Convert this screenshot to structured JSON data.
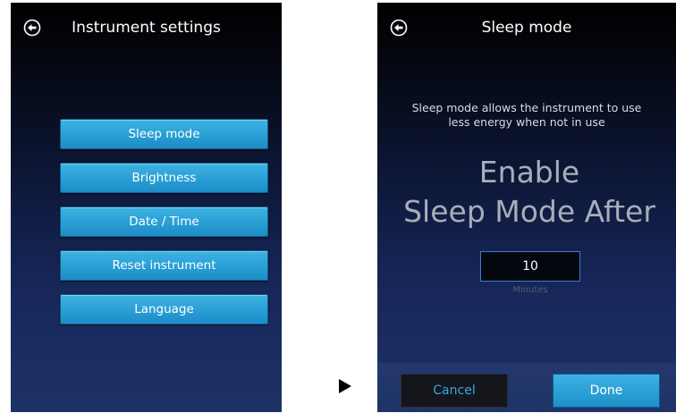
{
  "left_screen": {
    "title": "Instrument settings",
    "back_icon": "back-arrow-circle-icon",
    "menu": [
      {
        "label": "Sleep mode"
      },
      {
        "label": "Brightness"
      },
      {
        "label": "Date / Time"
      },
      {
        "label": "Reset instrument"
      },
      {
        "label": "Language"
      }
    ]
  },
  "right_screen": {
    "title": "Sleep mode",
    "back_icon": "back-arrow-circle-icon",
    "description_line1": "Sleep mode allows the instrument to use",
    "description_line2": "less energy when not in use",
    "heading_line1": "Enable",
    "heading_line2": "Sleep Mode After",
    "minutes_value": "10",
    "minutes_label": "Minutes",
    "cancel_label": "Cancel",
    "done_label": "Done"
  },
  "transition_icon": "right-triangle-arrow-icon",
  "colors": {
    "button_blue": "#2aa0d6",
    "background_dark": "#000000",
    "background_navy": "#1e3268",
    "cancel_text": "#3aa6e0"
  }
}
